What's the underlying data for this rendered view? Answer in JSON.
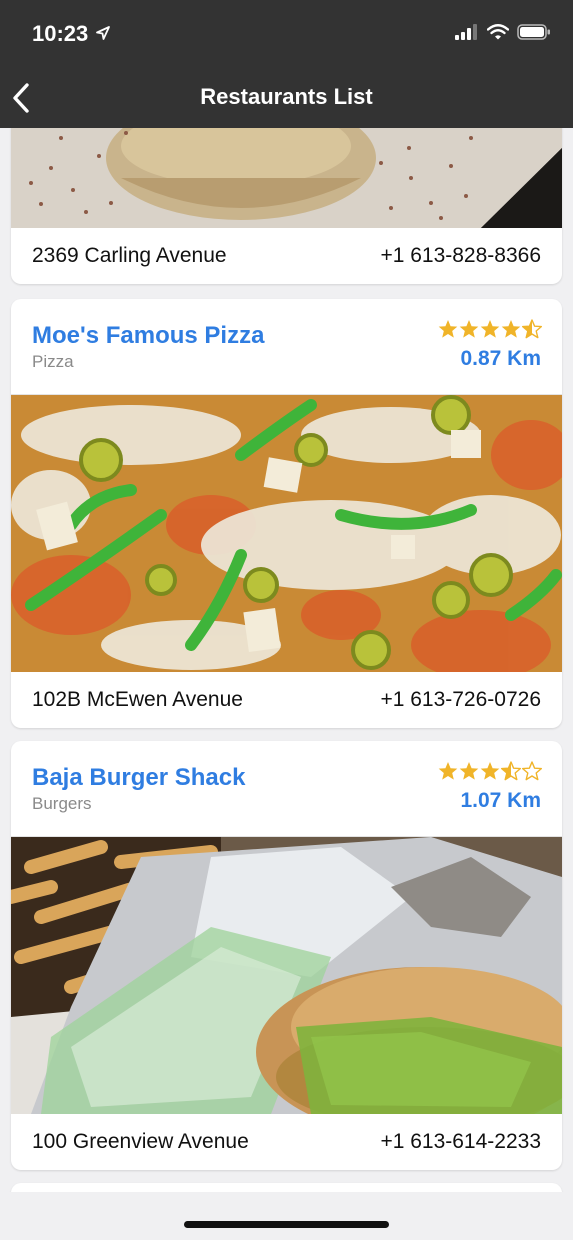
{
  "status_bar": {
    "time": "10:23",
    "location_icon": "location-arrow-icon",
    "signal_icon": "cellular-signal-icon",
    "wifi_icon": "wifi-icon",
    "battery_icon": "battery-icon"
  },
  "nav": {
    "title": "Restaurants List",
    "back_icon": "chevron-left-icon"
  },
  "colors": {
    "nav_background": "#333333",
    "accent": "#2f7de1",
    "star": "#f0b429",
    "background": "#f0f0f2"
  },
  "restaurants": [
    {
      "name": "",
      "category": "",
      "distance": "",
      "rating": null,
      "address": "2369 Carling Avenue",
      "phone": "+1 613-828-8366",
      "photo": "dessert photo (partially scrolled)"
    },
    {
      "name": "Moe's Famous Pizza",
      "category": "Pizza",
      "distance": "0.87 Km",
      "rating": 4.5,
      "address": "102B McEwen Avenue",
      "phone": "+1 613-726-0726",
      "photo": "pizza photo"
    },
    {
      "name": "Baja Burger Shack",
      "category": "Burgers",
      "distance": "1.07 Km",
      "rating": 3.5,
      "address": "100 Greenview Avenue",
      "phone": "+1 613-614-2233",
      "photo": "burger and fries photo"
    }
  ]
}
